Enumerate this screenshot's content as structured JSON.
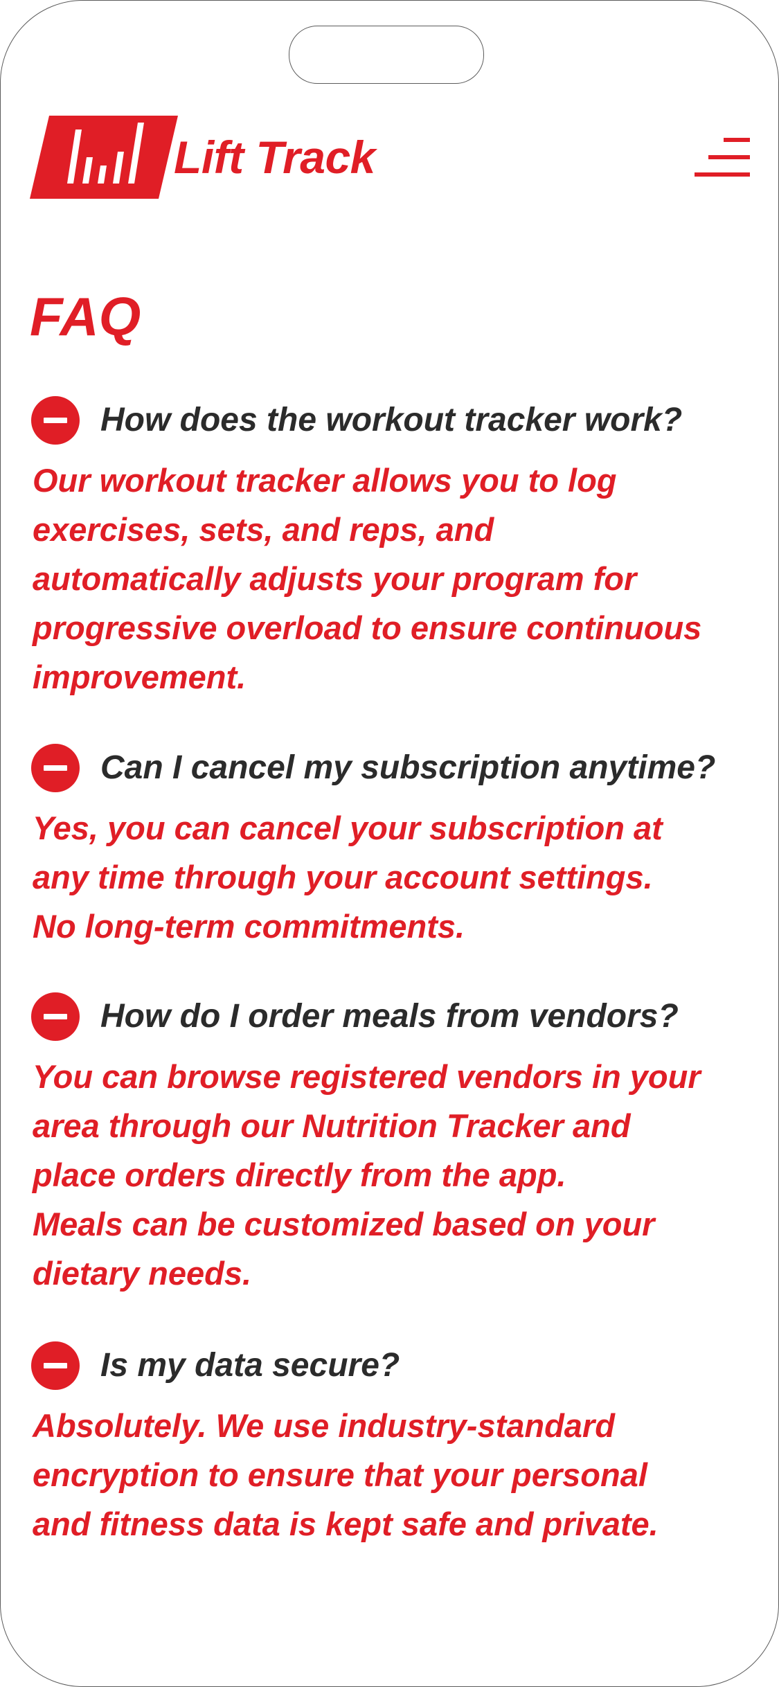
{
  "app": {
    "name": "Lift Track",
    "logo_icon": "barbell-chart-icon",
    "menu_icon": "hamburger-menu-icon",
    "accent_color": "#e01e26",
    "question_color": "#2b2b2b"
  },
  "page": {
    "title": "FAQ"
  },
  "faq": [
    {
      "question": "How does the workout tracker work?",
      "toggle_icon": "minus-circle-icon",
      "answer_lines": [
        "Our workout tracker allows you to log",
        "exercises, sets, and reps, and",
        "automatically adjusts your program for",
        "progressive overload to ensure continuous",
        "improvement."
      ]
    },
    {
      "question": "Can I cancel my subscription anytime?",
      "toggle_icon": "minus-circle-icon",
      "answer_lines": [
        "Yes, you can cancel your subscription at",
        "any time through your account settings.",
        "No long-term commitments."
      ]
    },
    {
      "question": "How do I order meals from vendors?",
      "toggle_icon": "minus-circle-icon",
      "answer_lines": [
        "You can browse registered vendors in your",
        "area through our Nutrition Tracker and",
        "place orders directly from the app.",
        "Meals can be customized based on your",
        "dietary needs."
      ]
    },
    {
      "question": "Is my data secure?",
      "toggle_icon": "minus-circle-icon",
      "answer_lines": [
        "Absolutely. We use industry-standard",
        "encryption to ensure that your personal",
        "and fitness data is kept safe and private."
      ]
    }
  ]
}
